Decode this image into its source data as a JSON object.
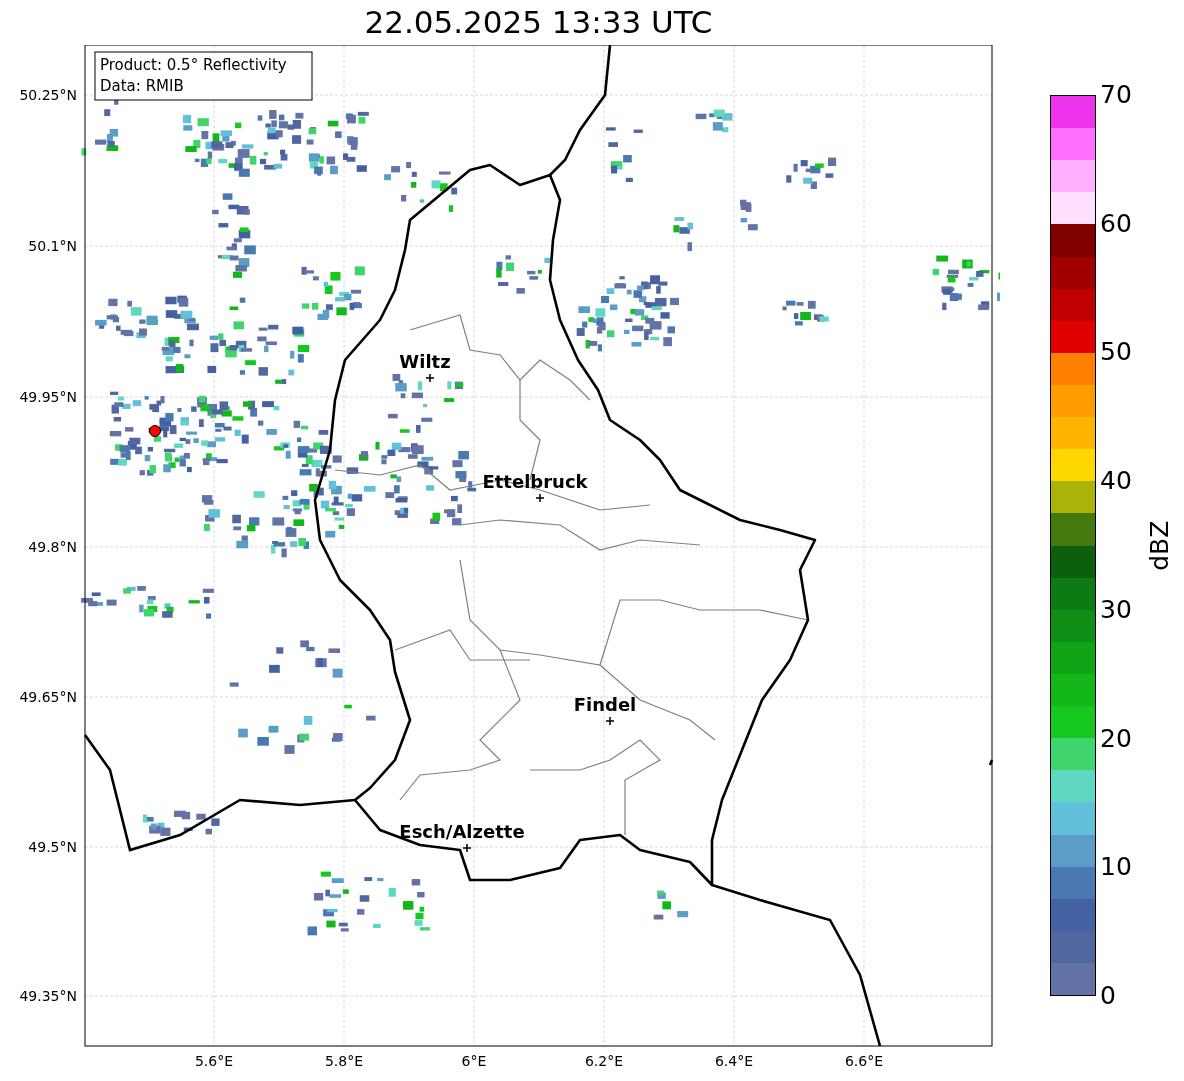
{
  "title": "22.05.2025 13:33 UTC",
  "info_box": [
    "Product: 0.5° Reflectivity",
    "Data: RMIB"
  ],
  "lat_ticks": [
    "50.25°N",
    "50.1°N",
    "49.95°N",
    "49.8°N",
    "49.65°N",
    "49.5°N",
    "49.35°N"
  ],
  "lon_ticks": [
    "5.6°E",
    "5.8°E",
    "6°E",
    "6.2°E",
    "6.4°E",
    "6.6°E"
  ],
  "cities": [
    {
      "name": "Wiltz"
    },
    {
      "name": "Ettelbruck"
    },
    {
      "name": "Findel"
    },
    {
      "name": "Esch/Alzette"
    }
  ],
  "colorbar": {
    "label": "dBZ",
    "ticks": [
      "70",
      "60",
      "50",
      "40",
      "30",
      "20",
      "10",
      "0"
    ],
    "segments": [
      {
        "color": "#ee33ee"
      },
      {
        "color": "#ff70ff"
      },
      {
        "color": "#ffb0ff"
      },
      {
        "color": "#ffe0ff"
      },
      {
        "color": "#800000"
      },
      {
        "color": "#a00000"
      },
      {
        "color": "#c00000"
      },
      {
        "color": "#e00000"
      },
      {
        "color": "#ff7f00"
      },
      {
        "color": "#ff9c00"
      },
      {
        "color": "#ffb400"
      },
      {
        "color": "#ffd700"
      },
      {
        "color": "#aab30a"
      },
      {
        "color": "#427a10"
      },
      {
        "color": "#0b5f0f"
      },
      {
        "color": "#0e7a12"
      },
      {
        "color": "#0f8d14"
      },
      {
        "color": "#10a316"
      },
      {
        "color": "#12b71a"
      },
      {
        "color": "#14c81e"
      },
      {
        "color": "#3fd46c"
      },
      {
        "color": "#5ed8c0"
      },
      {
        "color": "#63c0db"
      },
      {
        "color": "#5a9ec8"
      },
      {
        "color": "#4a78b0"
      },
      {
        "color": "#4461a3"
      },
      {
        "color": "#52679f"
      },
      {
        "color": "#6473a6"
      }
    ]
  }
}
